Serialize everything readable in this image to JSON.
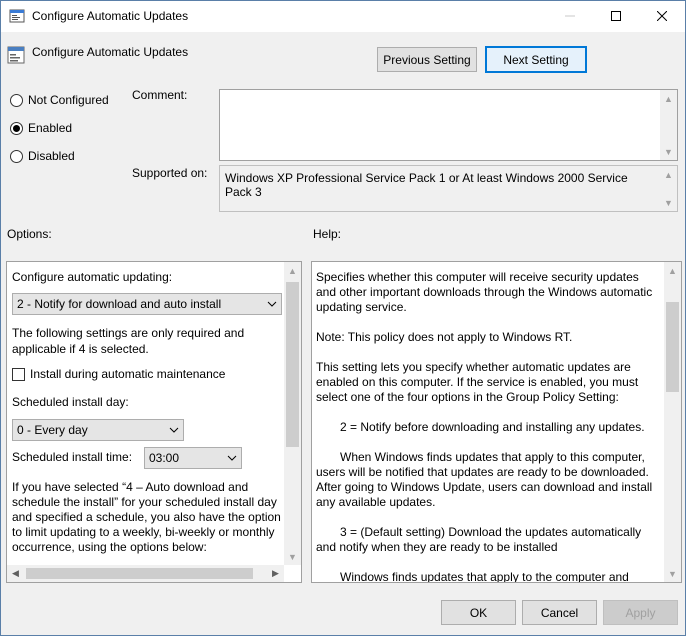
{
  "window": {
    "title": "Configure Automatic Updates",
    "minimize_icon": "minimize-icon",
    "maximize_icon": "maximize-icon",
    "close_icon": "close-icon"
  },
  "header": {
    "policy_title": "Configure Automatic Updates",
    "prev_button": "Previous Setting",
    "next_button": "Next Setting"
  },
  "state": {
    "options": [
      "Not Configured",
      "Enabled",
      "Disabled"
    ],
    "selected": "Enabled"
  },
  "comment": {
    "label": "Comment:",
    "value": ""
  },
  "supported": {
    "label": "Supported on:",
    "value": "Windows XP Professional Service Pack 1 or At least Windows 2000 Service Pack 3"
  },
  "options_panel": {
    "section_label": "Options:",
    "configure_label": "Configure automatic updating:",
    "configure_value": "2 - Notify for download and auto install",
    "note": "The following settings are only required and applicable if 4 is selected.",
    "maintenance_checkbox": "Install during automatic maintenance",
    "day_label": "Scheduled install day:",
    "day_value": "0 - Every day",
    "time_label": "Scheduled install time:",
    "time_value": "03:00",
    "schedule_text": "If you have selected “4 – Auto download and schedule the install” for your scheduled install day and specified a schedule, you also have the option to limit updating to a weekly, bi-weekly or monthly occurrence, using the options below:"
  },
  "help_panel": {
    "section_label": "Help:",
    "paragraphs": [
      "Specifies whether this computer will receive security updates and other important downloads through the Windows automatic updating service.",
      "Note: This policy does not apply to Windows RT.",
      "This setting lets you specify whether automatic updates are enabled on this computer. If the service is enabled, you must select one of the four options in the Group Policy Setting:",
      "2 = Notify before downloading and installing any updates.",
      "When Windows finds updates that apply to this computer, users will be notified that updates are ready to be downloaded. After going to Windows Update, users can download and install any available updates.",
      "3 = (Default setting) Download the updates automatically and notify when they are ready to be installed",
      "Windows finds updates that apply to the computer and"
    ]
  },
  "footer": {
    "ok": "OK",
    "cancel": "Cancel",
    "apply": "Apply"
  }
}
